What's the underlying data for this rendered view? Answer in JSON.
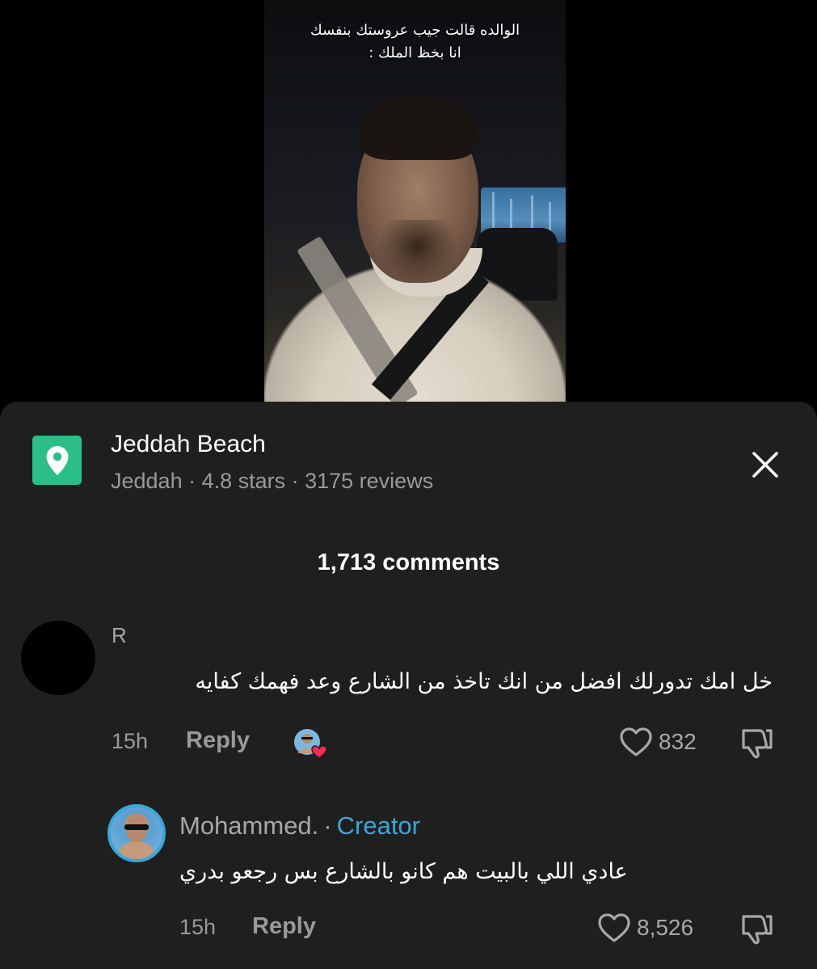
{
  "video": {
    "caption_line1": "الوالده قالت جيب عروستك بنفسك",
    "caption_line2": "انا بخظ الملك :"
  },
  "place": {
    "title": "Jeddah Beach",
    "subtitle": "Jeddah · 4.8 stars · 3175 reviews",
    "icon": "map-pin-icon",
    "icon_color": "#2bbf87"
  },
  "comments_header": {
    "count_label": "1,713 comments"
  },
  "comments": [
    {
      "username": "R",
      "text": "خل امك تدورلك افضل من انك تاخذ من الشارع وعد فهمك كفايه",
      "time": "15h",
      "reply_label": "Reply",
      "likes": "832",
      "liked_by_creator": true
    },
    {
      "username": "Mohammed.",
      "badge": "Creator",
      "badge_separator": "·",
      "text": "عادي اللي بالبيت هم كانو بالشارع بس رجعو بدري",
      "time": "15h",
      "reply_label": "Reply",
      "likes": "8,526"
    }
  ],
  "colors": {
    "sheet_bg": "#1f1f1f",
    "creator_accent": "#3aa7d6",
    "muted_text": "#9a9a9a",
    "heart_red": "#ff2d55"
  }
}
